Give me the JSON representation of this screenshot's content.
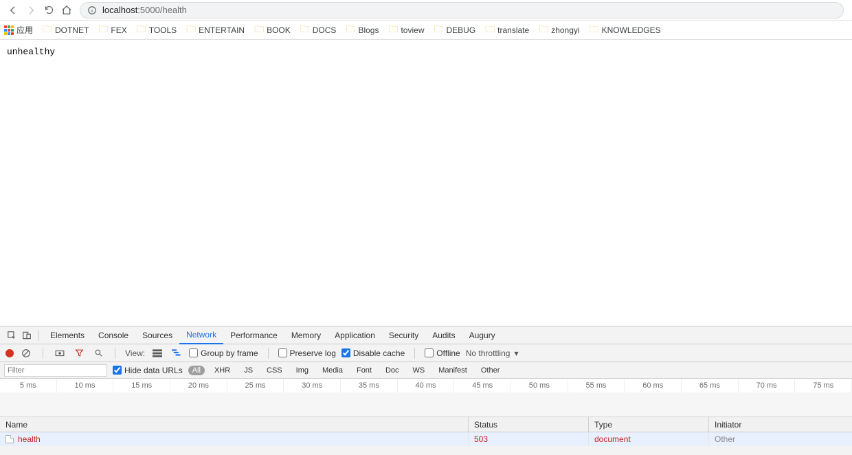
{
  "browser": {
    "url_host": "localhost",
    "url_port": ":5000",
    "url_path": "/health"
  },
  "bookmarks": {
    "apps_label": "应用",
    "items": [
      "DOTNET",
      "FEX",
      "TOOLS",
      "ENTERTAIN",
      "BOOK",
      "DOCS",
      "Blogs",
      "toview",
      "DEBUG",
      "translate",
      "zhongyi",
      "KNOWLEDGES"
    ]
  },
  "page_body": "unhealthy",
  "devtools": {
    "tabs": [
      "Elements",
      "Console",
      "Sources",
      "Network",
      "Performance",
      "Memory",
      "Application",
      "Security",
      "Audits",
      "Augury"
    ],
    "active_tab": "Network",
    "netbar": {
      "view_label": "View:",
      "group_by_frame": "Group by frame",
      "preserve_log": "Preserve log",
      "disable_cache": "Disable cache",
      "offline": "Offline",
      "throttling": "No throttling"
    },
    "filter": {
      "placeholder": "Filter",
      "hide_data_urls": "Hide data URLs",
      "types": [
        "All",
        "XHR",
        "JS",
        "CSS",
        "Img",
        "Media",
        "Font",
        "Doc",
        "WS",
        "Manifest",
        "Other"
      ],
      "active_type": "All"
    },
    "timeline_ticks": [
      "5 ms",
      "10 ms",
      "15 ms",
      "20 ms",
      "25 ms",
      "30 ms",
      "35 ms",
      "40 ms",
      "45 ms",
      "50 ms",
      "55 ms",
      "60 ms",
      "65 ms",
      "70 ms",
      "75 ms"
    ],
    "table": {
      "headers": {
        "name": "Name",
        "status": "Status",
        "type": "Type",
        "initiator": "Initiator"
      },
      "row": {
        "name": "health",
        "status": "503",
        "type": "document",
        "initiator": "Other"
      }
    }
  }
}
